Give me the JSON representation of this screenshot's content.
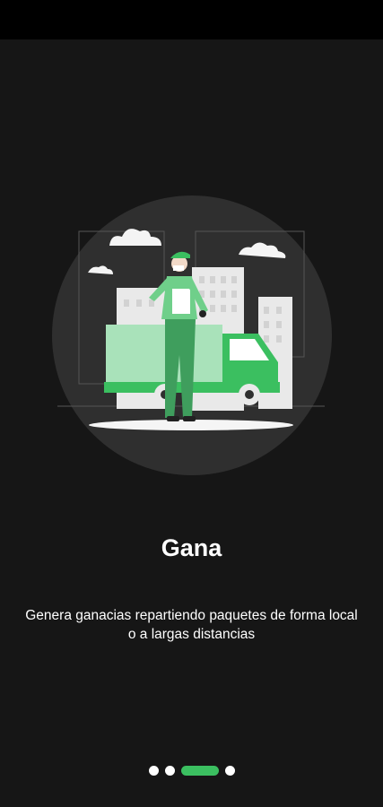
{
  "onboarding": {
    "title": "Gana",
    "description_line1": "Genera ganacias repartiendo paquetes de forma local",
    "description_line2": "o a largas distancias",
    "illustration": "delivery-person-with-truck-illustration",
    "accent_color": "#3bbf60"
  },
  "pager": {
    "total": 4,
    "active_index": 2
  }
}
